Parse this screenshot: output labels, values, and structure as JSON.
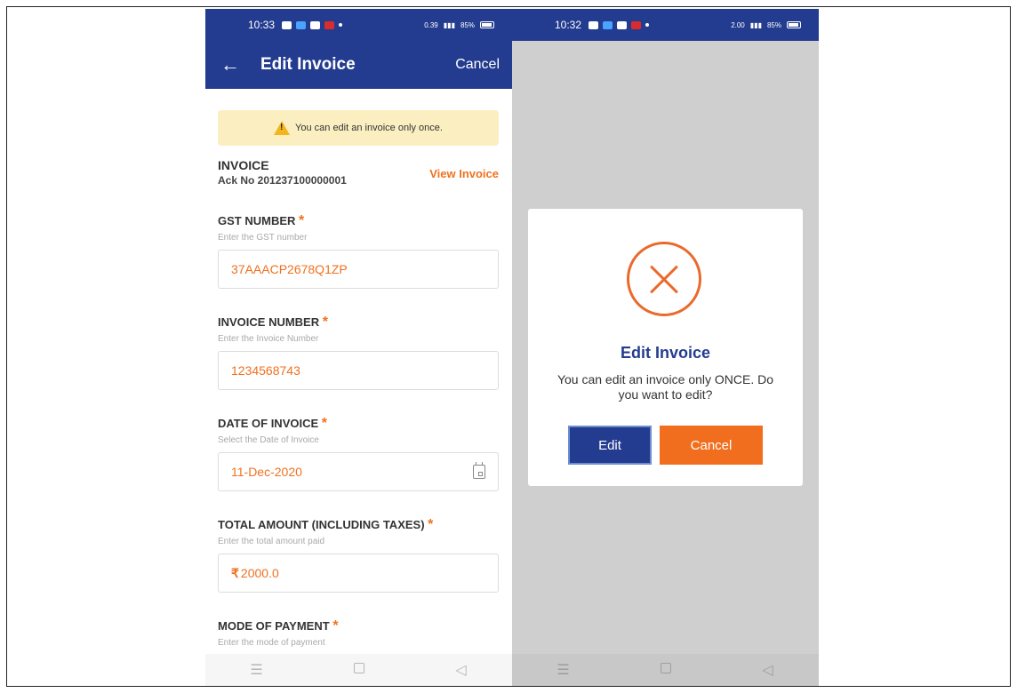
{
  "left": {
    "status": {
      "time": "10:33",
      "speed": "0.39",
      "battery": "85%"
    },
    "appbar": {
      "title": "Edit Invoice",
      "cancel": "Cancel"
    },
    "warning": "You can edit an invoice only once.",
    "invoice": {
      "label": "INVOICE",
      "ack": "Ack No 201237100000001",
      "view": "View Invoice"
    },
    "fields": [
      {
        "label": "GST NUMBER",
        "help": "Enter the GST number",
        "value": "37AAACP2678Q1ZP"
      },
      {
        "label": "INVOICE NUMBER",
        "help": "Enter the Invoice Number",
        "value": "1234568743"
      },
      {
        "label": "DATE OF INVOICE",
        "help": "Select the Date of Invoice",
        "value": "11-Dec-2020"
      },
      {
        "label": "TOTAL AMOUNT (INCLUDING TAXES)",
        "help": "Enter the total amount paid",
        "value": "2000.0",
        "currency": "₹"
      },
      {
        "label": "MODE OF PAYMENT",
        "help": "Enter the mode of payment"
      }
    ]
  },
  "right": {
    "status": {
      "time": "10:32",
      "speed": "2.00",
      "battery": "85%"
    },
    "dialog": {
      "title": "Edit Invoice",
      "message": "You can edit an invoice only ONCE. Do you want to edit?",
      "edit": "Edit",
      "cancel": "Cancel"
    }
  },
  "star": "*",
  "icons": [
    "back-arrow-icon",
    "warning-icon",
    "calendar-icon",
    "x-circle-icon",
    "menu-icon",
    "home-icon",
    "back-icon"
  ],
  "colors": {
    "primary": "#233c8f",
    "accent": "#f0711f",
    "warning_bg": "#fbefc2"
  }
}
